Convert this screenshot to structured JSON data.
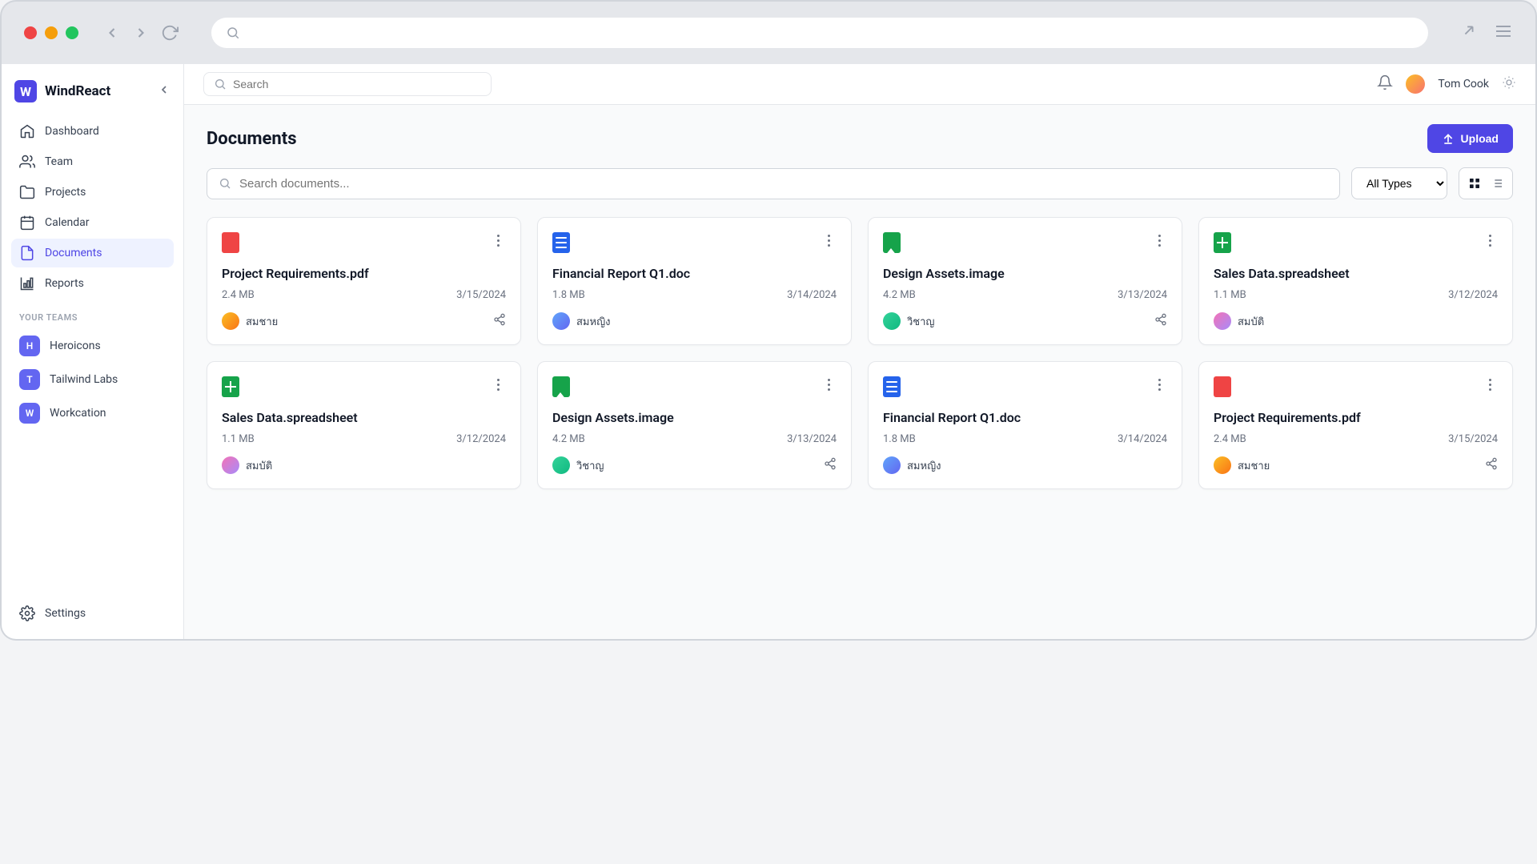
{
  "chrome": {
    "url_search_icon": "search"
  },
  "brand": {
    "badge": "W",
    "name": "WindReact"
  },
  "sidebar": {
    "nav": [
      {
        "icon": "home",
        "label": "Dashboard",
        "active": false
      },
      {
        "icon": "users",
        "label": "Team",
        "active": false
      },
      {
        "icon": "folder",
        "label": "Projects",
        "active": false
      },
      {
        "icon": "calendar",
        "label": "Calendar",
        "active": false
      },
      {
        "icon": "document",
        "label": "Documents",
        "active": true
      },
      {
        "icon": "chart",
        "label": "Reports",
        "active": false
      }
    ],
    "teams_label": "YOUR TEAMS",
    "teams": [
      {
        "initial": "H",
        "label": "Heroicons"
      },
      {
        "initial": "T",
        "label": "Tailwind Labs"
      },
      {
        "initial": "W",
        "label": "Workcation"
      }
    ],
    "settings_label": "Settings"
  },
  "topbar": {
    "search_placeholder": "Search",
    "user_name": "Tom Cook"
  },
  "page": {
    "title": "Documents",
    "upload_label": "Upload",
    "doc_search_placeholder": "Search documents...",
    "type_filter": "All Types"
  },
  "documents": [
    {
      "type": "pdf",
      "name": "Project Requirements.pdf",
      "size": "2.4 MB",
      "date": "3/15/2024",
      "owner": "สมชาย",
      "avatar": 0,
      "share": true
    },
    {
      "type": "doc",
      "name": "Financial Report Q1.doc",
      "size": "1.8 MB",
      "date": "3/14/2024",
      "owner": "สมหญิง",
      "avatar": 1,
      "share": false
    },
    {
      "type": "image",
      "name": "Design Assets.image",
      "size": "4.2 MB",
      "date": "3/13/2024",
      "owner": "วิชาญ",
      "avatar": 2,
      "share": true
    },
    {
      "type": "sheet",
      "name": "Sales Data.spreadsheet",
      "size": "1.1 MB",
      "date": "3/12/2024",
      "owner": "สมบัติ",
      "avatar": 3,
      "share": false
    },
    {
      "type": "sheet",
      "name": "Sales Data.spreadsheet",
      "size": "1.1 MB",
      "date": "3/12/2024",
      "owner": "สมบัติ",
      "avatar": 3,
      "share": false
    },
    {
      "type": "image",
      "name": "Design Assets.image",
      "size": "4.2 MB",
      "date": "3/13/2024",
      "owner": "วิชาญ",
      "avatar": 2,
      "share": true
    },
    {
      "type": "doc",
      "name": "Financial Report Q1.doc",
      "size": "1.8 MB",
      "date": "3/14/2024",
      "owner": "สมหญิง",
      "avatar": 1,
      "share": false
    },
    {
      "type": "pdf",
      "name": "Project Requirements.pdf",
      "size": "2.4 MB",
      "date": "3/15/2024",
      "owner": "สมชาย",
      "avatar": 0,
      "share": true
    }
  ]
}
